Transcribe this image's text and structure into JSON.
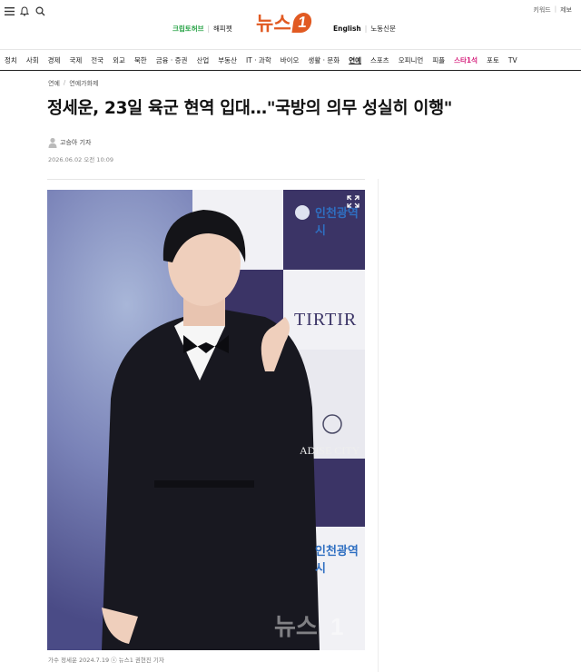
{
  "header": {
    "icons": [
      "menu-icon",
      "bell-icon",
      "search-icon"
    ],
    "top_links": [
      "키워드",
      "제보"
    ],
    "sub_left": [
      "크립토허브",
      "해피펫"
    ],
    "logo_text": "뉴스",
    "logo_badge": "1",
    "sub_right": [
      "English",
      "노동신문"
    ]
  },
  "nav": {
    "items": [
      "정치",
      "사회",
      "경제",
      "국제",
      "전국",
      "외교",
      "북한",
      "금융 · 증권",
      "산업",
      "부동산",
      "IT · 과학",
      "바이오",
      "생활 · 문화",
      "연예",
      "스포츠",
      "오피니언",
      "피플",
      "스타1석",
      "포토",
      "TV"
    ],
    "active": "연예"
  },
  "article": {
    "breadcrumb": [
      "연예",
      "연예가화제"
    ],
    "title": "정세운, 23일 육군 현역 입대…\"국방의 의무 성실히 이행\"",
    "author": "고승아 기자",
    "date": "2026.06.02 오전 10:09",
    "photo_alt": "가수 정세운",
    "watermark": "뉴스1",
    "caption": "가수 정세운 2024.7.19 ⓢ 뉴스1 권현진 기자"
  },
  "backdrop": {
    "lines": [
      "인천광역시",
      "TIRTIR",
      "ADISE CITY",
      "인천광역시"
    ]
  },
  "colors": {
    "brand": "#e15a22",
    "green": "#25a244",
    "pink": "#d6247e",
    "backdrop_purple": "#3b3466"
  }
}
